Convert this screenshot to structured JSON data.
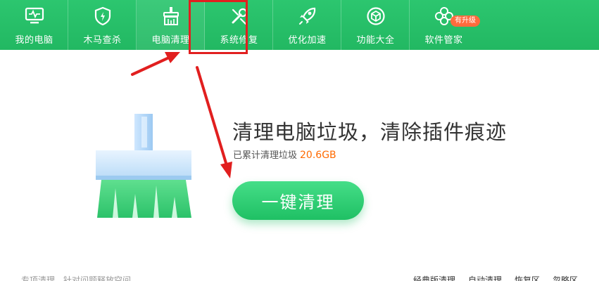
{
  "nav": {
    "items": [
      {
        "label": "我的电脑",
        "icon": "monitor-icon"
      },
      {
        "label": "木马查杀",
        "icon": "shield-icon"
      },
      {
        "label": "电脑清理",
        "icon": "broom-icon"
      },
      {
        "label": "系统修复",
        "icon": "wrench-icon"
      },
      {
        "label": "优化加速",
        "icon": "rocket-icon"
      },
      {
        "label": "功能大全",
        "icon": "cube-icon"
      },
      {
        "label": "软件管家",
        "icon": "clover-icon"
      }
    ],
    "active_index": 2,
    "badge": "有升级"
  },
  "hero": {
    "headline": "清理电脑垃圾，清除插件痕迹",
    "stat_label": "已累计清理垃圾",
    "stat_value": "20.6GB",
    "button_label": "一键清理"
  },
  "footer": {
    "left_text": "专项清理　针对问题释放空间",
    "links": [
      "经典版清理",
      "自动清理",
      "恢复区",
      "忽略区"
    ]
  },
  "colors": {
    "nav_green": "#22b862",
    "button_green": "#1fc064",
    "stat_orange": "#ff6a00",
    "annotation_red": "#e11f1f",
    "badge_orange": "#ff6b3d"
  }
}
